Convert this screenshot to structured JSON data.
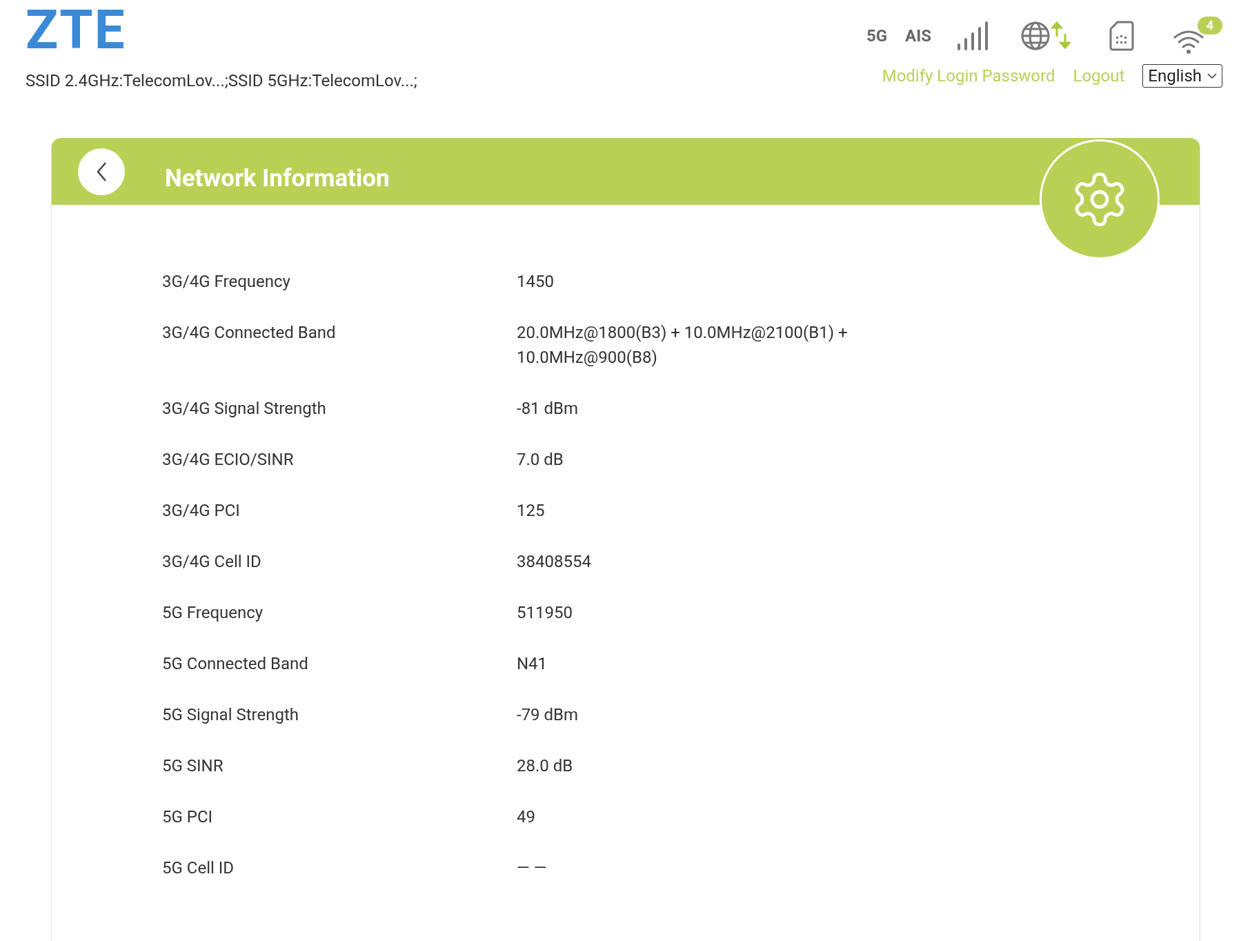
{
  "logo": "ZTE",
  "ssid_line": "SSID 2.4GHz:TelecomLov...;SSID 5GHz:TelecomLov...;",
  "status": {
    "network_type": "5G",
    "operator": "AIS",
    "wifi_clients": "4"
  },
  "links": [
    "Modify Login Password",
    "Logout"
  ],
  "language": {
    "value": "English"
  },
  "panel": {
    "title": "Network Information",
    "rows": [
      {
        "label": "3G/4G Frequency",
        "value": "1450"
      },
      {
        "label": "3G/4G Connected Band",
        "value": "20.0MHz@1800(B3) + 10.0MHz@2100(B1) + 10.0MHz@900(B8)"
      },
      {
        "label": "3G/4G Signal Strength",
        "value": "-81 dBm"
      },
      {
        "label": "3G/4G ECIO/SINR",
        "value": "7.0 dB"
      },
      {
        "label": "3G/4G PCI",
        "value": "125"
      },
      {
        "label": "3G/4G Cell ID",
        "value": "38408554"
      },
      {
        "label": "5G Frequency",
        "value": "511950"
      },
      {
        "label": "5G Connected Band",
        "value": "N41"
      },
      {
        "label": "5G Signal Strength",
        "value": "-79 dBm"
      },
      {
        "label": "5G SINR",
        "value": "28.0 dB"
      },
      {
        "label": "5G PCI",
        "value": "49"
      },
      {
        "label": "5G Cell ID",
        "value": "— —"
      }
    ]
  }
}
